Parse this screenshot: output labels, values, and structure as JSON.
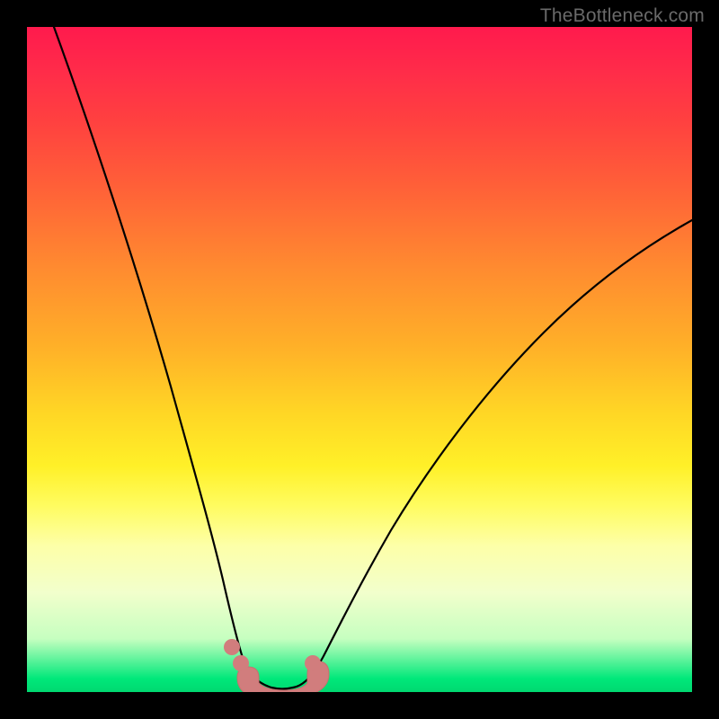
{
  "watermark": "TheBottleneck.com",
  "colors": {
    "frame": "#000000",
    "curve": "#000000",
    "marker": "#d17d7d",
    "gradient_top": "#ff1a4d",
    "gradient_bottom": "#00d870"
  },
  "chart_data": {
    "type": "line",
    "title": "",
    "xlabel": "",
    "ylabel": "",
    "xlim": [
      0,
      100
    ],
    "ylim": [
      0,
      100
    ],
    "note": "No axes, ticks, or numeric labels are rendered; values are estimated from pixel geometry only.",
    "series": [
      {
        "name": "left-curve",
        "x": [
          4,
          8,
          12,
          16,
          20,
          24,
          26,
          28,
          29.5,
          30.5,
          31.5,
          32.5,
          33.5,
          35.5,
          38
        ],
        "y": [
          100,
          88,
          76,
          63,
          49,
          33,
          25,
          17,
          10,
          6,
          3.5,
          2,
          1.2,
          0.6,
          0.3
        ]
      },
      {
        "name": "right-curve",
        "x": [
          38,
          40,
          42,
          45,
          48,
          52,
          58,
          66,
          76,
          88,
          100
        ],
        "y": [
          0.3,
          1.5,
          4,
          9,
          15,
          23,
          33,
          44,
          55,
          64,
          71
        ]
      }
    ],
    "markers": {
      "name": "bottom-region",
      "shape": "rounded-band",
      "approx_x_range": [
        29,
        42
      ],
      "approx_y": 0.5,
      "extra_dots_x": [
        29.5,
        31,
        41
      ],
      "extra_dots_y": [
        6,
        3.2,
        3.2
      ]
    }
  }
}
